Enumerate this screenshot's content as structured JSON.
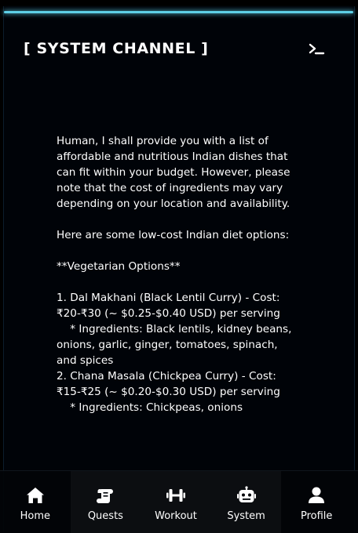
{
  "header": {
    "title": "[ SYSTEM CHANNEL ]",
    "terminal_icon": "terminal-icon"
  },
  "message": {
    "text": "Human, I shall provide you with a list of affordable and nutritious Indian dishes that can fit within your budget. However, please note that the cost of ingredients may vary depending on your location and availability.\n\nHere are some low-cost Indian diet options:\n\n**Vegetarian Options**\n\n1. Dal Makhani (Black Lentil Curry) - Cost: ₹20-₹30 (~ $0.25-$0.40 USD) per serving\n    * Ingredients: Black lentils, kidney beans, onions, garlic, ginger, tomatoes, spinach, and spices\n2. Chana Masala (Chickpea Curry) - Cost: ₹15-₹25 (~ $0.20-$0.30 USD) per serving\n    * Ingredients: Chickpeas, onions"
  },
  "nav": {
    "items": [
      {
        "label": "Home",
        "icon": "home-icon"
      },
      {
        "label": "Quests",
        "icon": "scroll-icon"
      },
      {
        "label": "Workout",
        "icon": "dumbbell-icon"
      },
      {
        "label": "System",
        "icon": "robot-icon"
      },
      {
        "label": "Profile",
        "icon": "user-icon"
      }
    ]
  },
  "colors": {
    "background": "#000308",
    "accent_glow": "#5ecfe6",
    "text": "#ffffff"
  }
}
